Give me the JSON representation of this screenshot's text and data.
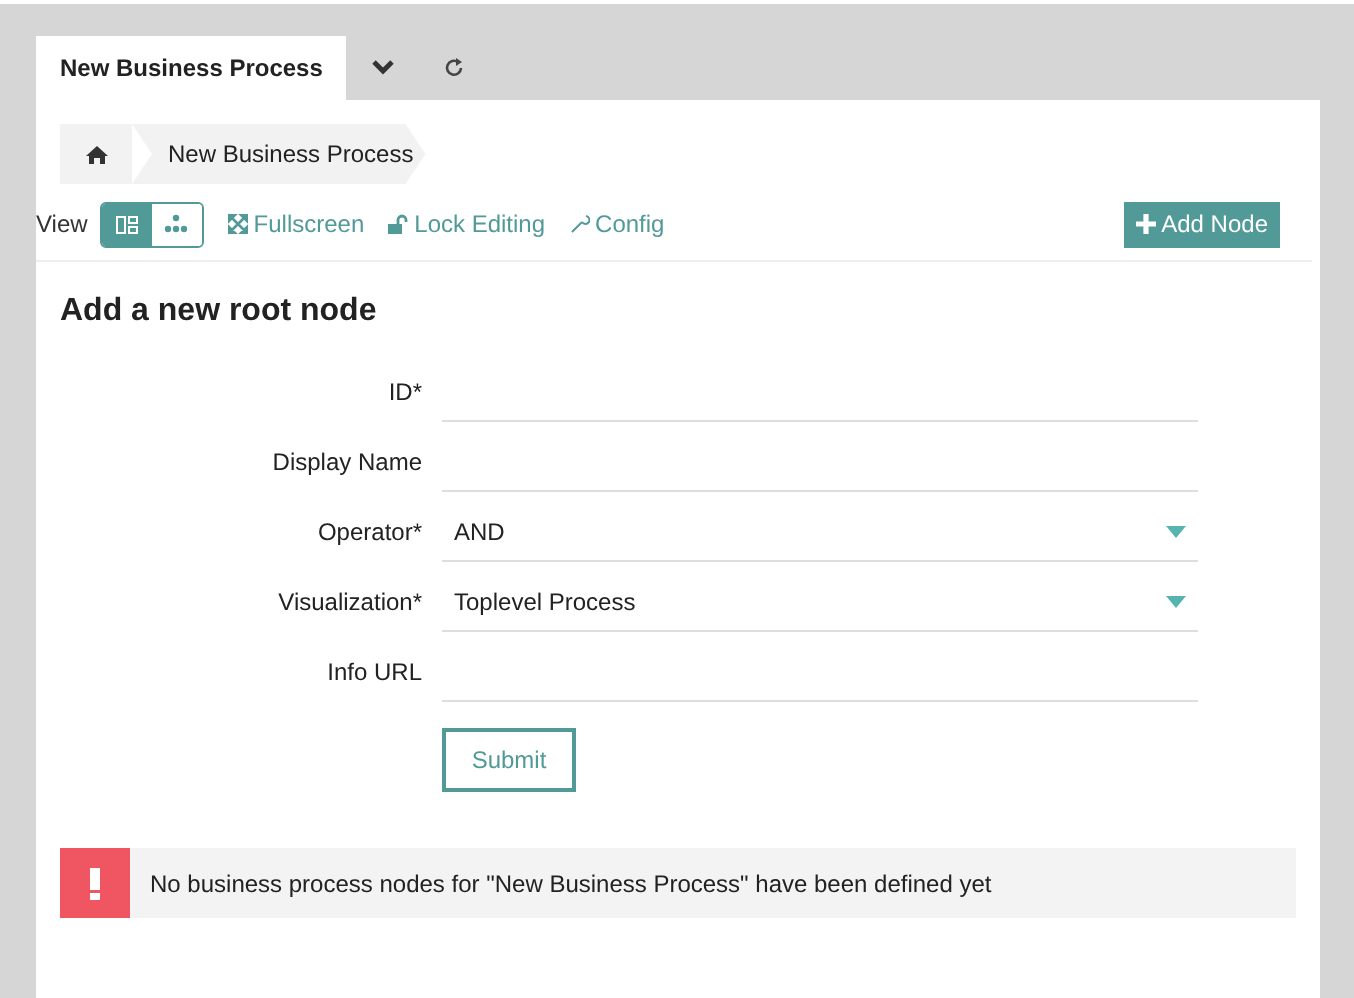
{
  "tabs": [
    {
      "label": "New Business Process",
      "selected": true
    }
  ],
  "breadcrumb": [
    "New Business Process"
  ],
  "toolbar": {
    "view_label": "View",
    "view_modes": [
      {
        "kind": "tiles",
        "selected": true
      },
      {
        "kind": "tree",
        "selected": false
      }
    ],
    "links": [
      {
        "kind": "fullscreen",
        "label": "Fullscreen"
      },
      {
        "kind": "lock",
        "label": "Lock Editing"
      },
      {
        "kind": "config",
        "label": "Config"
      }
    ],
    "add_button": "Add Node"
  },
  "form": {
    "title": "Add a new root node",
    "fields": [
      {
        "kind": "text",
        "label": "ID*"
      },
      {
        "kind": "text",
        "label": "Display Name"
      },
      {
        "kind": "select",
        "label": "Operator*",
        "value": "AND"
      },
      {
        "kind": "select",
        "label": "Visualization*",
        "value": "Toplevel Process"
      },
      {
        "kind": "text",
        "label": "Info URL"
      }
    ],
    "submit": "Submit"
  },
  "alert": {
    "text": "No business process nodes for \"New Business Process\" have been defined yet"
  }
}
